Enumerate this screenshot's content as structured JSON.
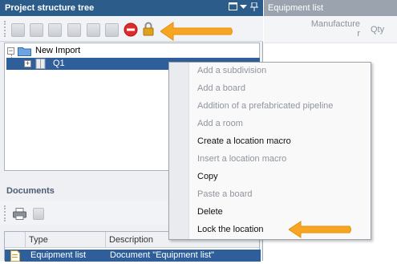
{
  "tree_panel": {
    "title": "Project structure tree",
    "window_controls": [
      "restore-icon",
      "dropdown-icon",
      "pin-icon"
    ],
    "toolbar_icons": [
      "add-node-icon",
      "add-child-icon",
      "add-sibling-icon",
      "board-icon",
      "copy-icon",
      "paste-icon",
      "delete-icon",
      "lock-icon"
    ],
    "nodes": [
      {
        "label": "New Import",
        "expander": "−",
        "icon": "folder-icon"
      },
      {
        "label": "Q1",
        "expander": "+",
        "icon": "location-icon",
        "selected": true
      }
    ]
  },
  "documents_panel": {
    "title": "Documents",
    "toolbar_icons": [
      "print-icon",
      "document-icon"
    ],
    "columns": [
      "Type",
      "Description"
    ],
    "rows": [
      {
        "type": "Equipment list",
        "description": "Document \"Equipment list\""
      }
    ]
  },
  "equipment_panel": {
    "title": "Equipment list",
    "columns": [
      "Manufacture\nr",
      "Qty"
    ]
  },
  "context_menu": {
    "items": [
      {
        "label": "Add a subdivision",
        "enabled": false
      },
      {
        "label": "Add a board",
        "enabled": false
      },
      {
        "label": "Addition of a prefabricated pipeline",
        "enabled": false
      },
      {
        "label": "Add a room",
        "enabled": false
      },
      {
        "label": "Create a location macro",
        "enabled": true
      },
      {
        "label": "Insert a location macro",
        "enabled": false
      },
      {
        "label": "Copy",
        "enabled": true
      },
      {
        "label": "Paste a board",
        "enabled": false
      },
      {
        "label": "Delete",
        "enabled": true
      },
      {
        "label": "Lock the location",
        "enabled": true
      }
    ]
  },
  "colors": {
    "header_blue": "#2b5c8a",
    "selection_blue": "#2f5f9b",
    "arrow_orange": "#f6a623",
    "delete_red": "#e02b2b",
    "lock_gold": "#e0a21a"
  }
}
